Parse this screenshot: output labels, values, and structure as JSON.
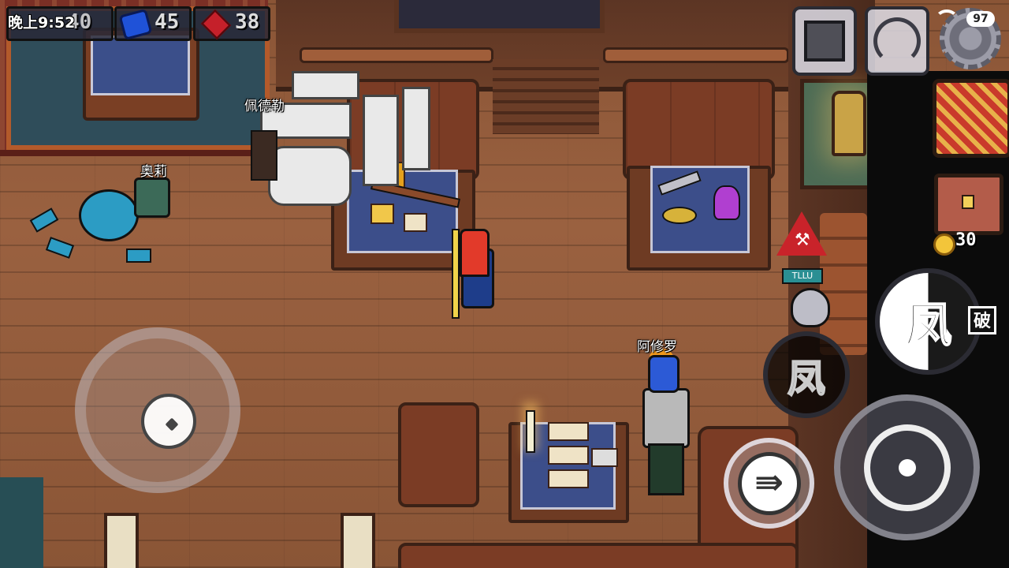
{
  "status_bar": {
    "time": "晚上9:52",
    "battery": "97"
  },
  "hud": {
    "blue_gem_count": "45",
    "red_gem_count": "38",
    "coin_count": "30",
    "hidden_counter": "40"
  },
  "npcs": [
    {
      "name": "佩德勒"
    },
    {
      "name": "奥莉"
    },
    {
      "name": "阿修罗"
    }
  ],
  "skills": {
    "main_glyph": "凤",
    "secondary_glyph": "凤",
    "break_badge": "破",
    "dash_glyph": "⇛"
  },
  "signs": {
    "warning_label": "TLLU"
  },
  "icons": {
    "gift": "gift-icon",
    "radar": "radar-icon",
    "settings": "gear-icon",
    "wifi": "wifi-icon",
    "cart": "shopping-cart-icon",
    "chest": "treasure-chest-icon",
    "coin": "coin-icon",
    "blue_gem": "blue-gem-icon",
    "red_gem": "red-gem-icon"
  }
}
